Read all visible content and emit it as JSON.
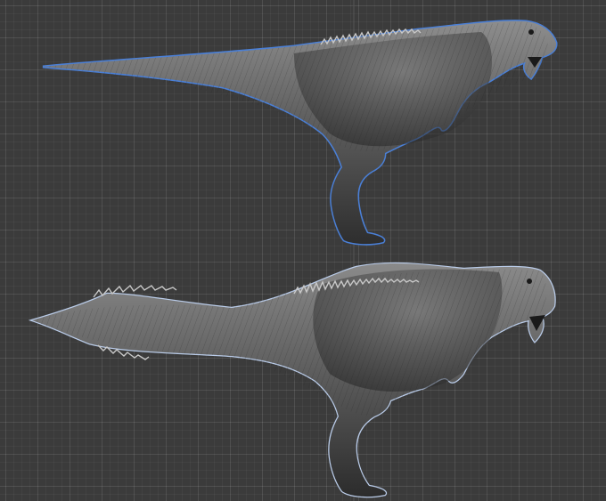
{
  "viewport": {
    "background": "#3b3b3b",
    "selection_outline": "#4a7fd6",
    "model_shade_dark": "#2c2c2c",
    "model_shade_mid": "#5c5c5c",
    "model_shade_light": "#8a8a8a"
  },
  "models": [
    {
      "id": "carnivore-model-top",
      "variant": "smooth-tail",
      "selected": true
    },
    {
      "id": "carnivore-model-bottom",
      "variant": "spiked-tail",
      "selected": true
    }
  ]
}
